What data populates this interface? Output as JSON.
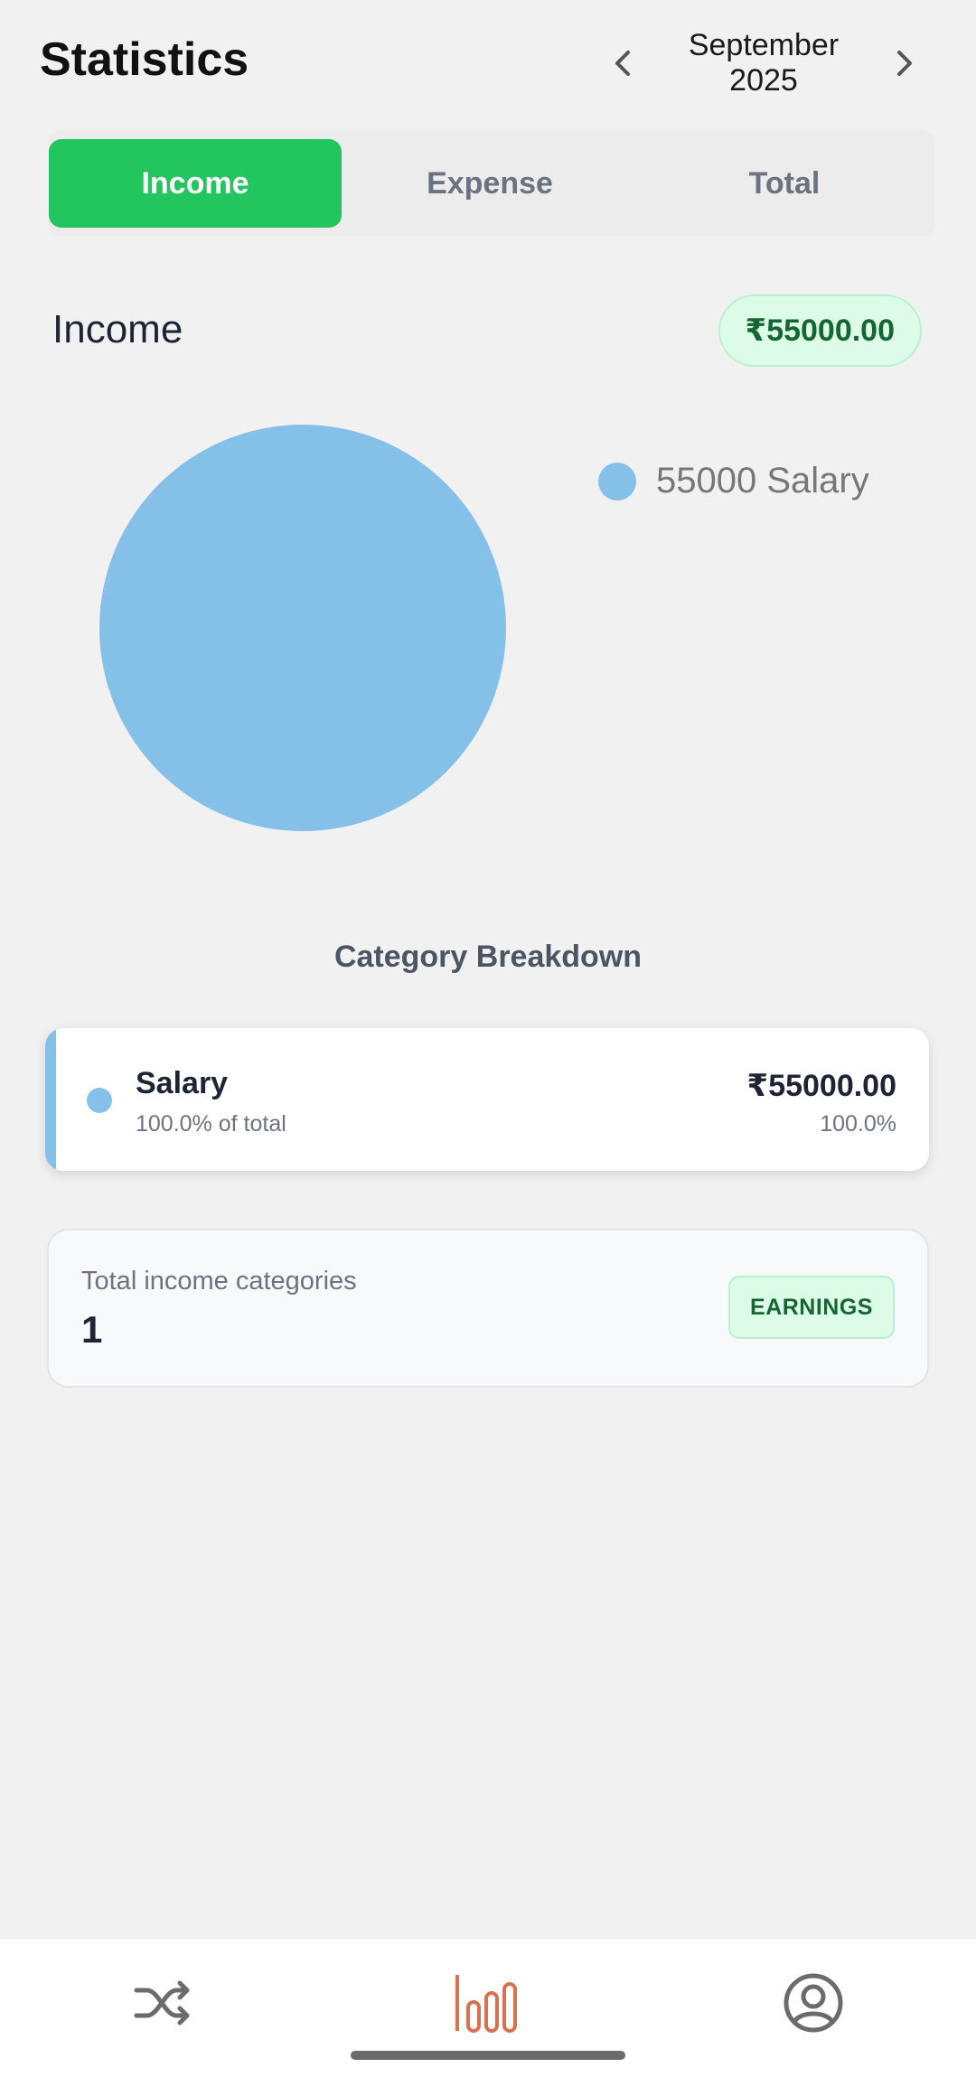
{
  "header": {
    "title": "Statistics",
    "month": "September 2025",
    "prev_icon": "chevron-left-icon",
    "next_icon": "chevron-right-icon"
  },
  "tabs": [
    {
      "label": "Income",
      "active": true
    },
    {
      "label": "Expense",
      "active": false
    },
    {
      "label": "Total",
      "active": false
    }
  ],
  "summary_header": {
    "heading": "Income",
    "total": "₹55000.00"
  },
  "pie": {
    "slices": [
      {
        "label": "Salary",
        "value": 55000,
        "color": "#85c0e9"
      }
    ],
    "legend": [
      {
        "text": "55000 Salary",
        "color": "#85c0e9"
      }
    ]
  },
  "breakdown": {
    "title": "Category Breakdown",
    "items": [
      {
        "name": "Salary",
        "share_text": "100.0% of total",
        "amount": "₹55000.00",
        "percent": "100.0%",
        "color": "#85c0e9"
      }
    ]
  },
  "summary_card": {
    "label": "Total income categories",
    "value": "1",
    "badge": "EARNINGS"
  },
  "bottom_nav": {
    "items": [
      {
        "icon": "shuffle-icon",
        "active": false
      },
      {
        "icon": "bar-chart-icon",
        "active": true
      },
      {
        "icon": "profile-icon",
        "active": false
      }
    ],
    "active_color": "#d9714e",
    "inactive_color": "#6b6b6b"
  },
  "colors": {
    "accent_green": "#22c55e",
    "background": "#f1f1f1"
  }
}
